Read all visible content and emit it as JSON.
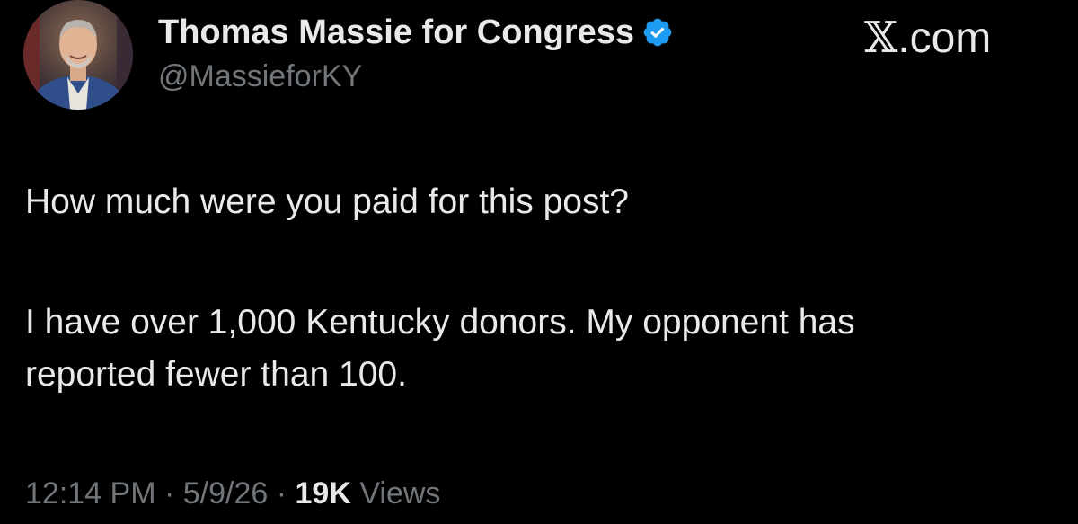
{
  "author": {
    "display_name": "Thomas Massie for Congress",
    "handle": "@MassieforKY",
    "verified": true,
    "verified_color": "#1d9bf0",
    "avatar_icon": "profile-photo"
  },
  "brand": {
    "x_glyph": "𝕏",
    "suffix": ".com"
  },
  "post": {
    "line1": "How much were you paid for this post?",
    "line2": "I have over 1,000 Kentucky donors. My opponent has",
    "line3": "reported fewer than 100."
  },
  "meta": {
    "time": "12:14 PM",
    "sep1": " · ",
    "date": "5/9/26",
    "sep2": " · ",
    "views_count": "19K",
    "views_label": " Views"
  },
  "colors": {
    "background": "#000000",
    "primary_text": "#e7e9ea",
    "secondary_text": "#71767b"
  }
}
